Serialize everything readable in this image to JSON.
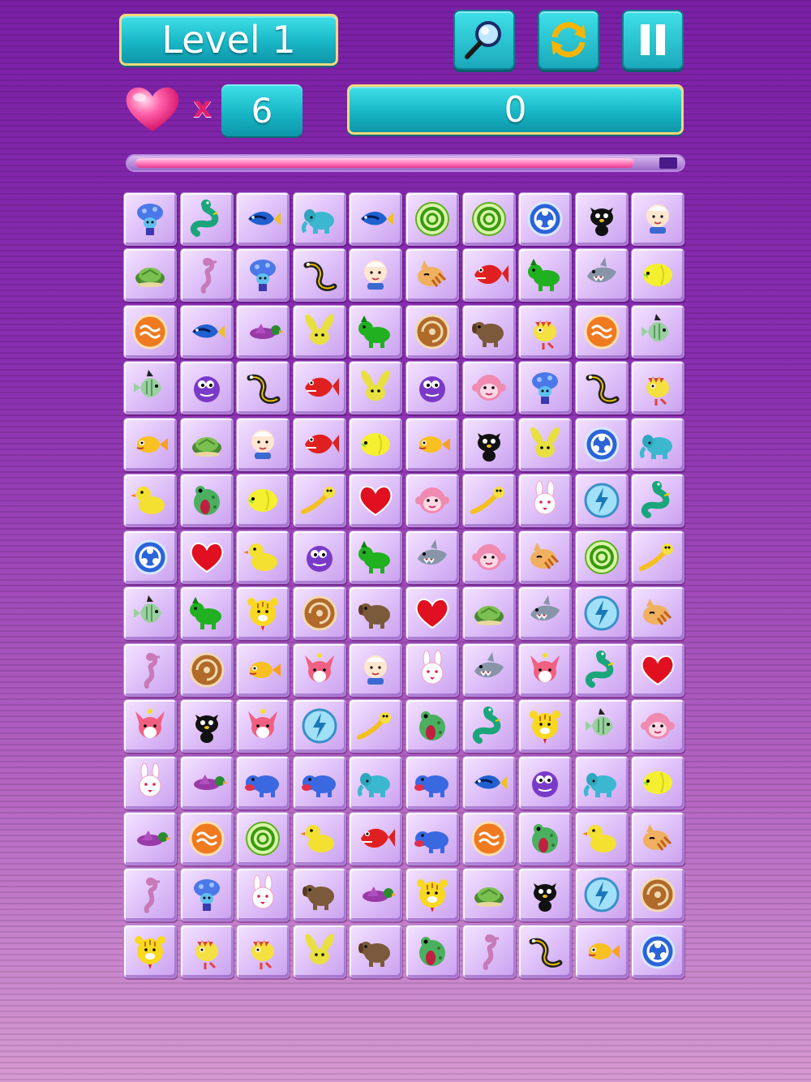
{
  "hud": {
    "level_label": "Level 1",
    "lives": "6",
    "lives_symbol": "x",
    "score": "0",
    "timer_remaining_fraction": 0.96
  },
  "buttons": {
    "hint_icon": "magnifier-icon",
    "shuffle_icon": "shuffle-icon",
    "pause_icon": "pause-icon"
  },
  "board": {
    "rows": 14,
    "cols": 10,
    "tiles": [
      [
        "mushroom-boy",
        "snake",
        "blue-fish",
        "elephant",
        "blue-fish",
        "green-orb",
        "green-orb",
        "blue-orb",
        "black-cat",
        "baby"
      ],
      [
        "turtle",
        "seahorse",
        "mushroom-boy",
        "eel",
        "baby",
        "striped-cat",
        "red-fish",
        "green-dog",
        "shark",
        "yellow-fish"
      ],
      [
        "fire-orb",
        "blue-fish",
        "duck-flying",
        "bunny-ears",
        "green-dog",
        "brown-orb",
        "brown-dog",
        "spiky-fish",
        "fire-orb",
        "angel-fish"
      ],
      [
        "angel-fish",
        "purple-blob",
        "eel",
        "red-fish",
        "bunny-ears",
        "purple-blob",
        "monkey",
        "mushroom-boy",
        "eel",
        "spiky-fish"
      ],
      [
        "goldfish",
        "turtle",
        "baby",
        "red-fish",
        "yellow-fish",
        "goldfish",
        "black-cat",
        "bunny-ears",
        "blue-orb",
        "elephant"
      ],
      [
        "rubber-duck",
        "frog",
        "yellow-fish",
        "comet",
        "heart",
        "monkey",
        "comet",
        "white-bunny",
        "lightning-orb",
        "snake"
      ],
      [
        "blue-orb",
        "heart",
        "rubber-duck",
        "purple-blob",
        "green-dog",
        "shark",
        "monkey",
        "striped-cat",
        "green-orb",
        "comet"
      ],
      [
        "angel-fish",
        "green-dog",
        "tiger",
        "brown-orb",
        "brown-dog",
        "heart",
        "turtle",
        "shark",
        "lightning-orb",
        "striped-cat"
      ],
      [
        "seahorse",
        "brown-orb",
        "goldfish",
        "fox",
        "baby",
        "white-bunny",
        "shark",
        "fox",
        "snake",
        "heart"
      ],
      [
        "fox",
        "black-cat",
        "fox",
        "lightning-orb",
        "comet",
        "frog",
        "snake",
        "tiger",
        "angel-fish",
        "monkey"
      ],
      [
        "white-bunny",
        "duck-flying",
        "blue-dog",
        "blue-dog",
        "elephant",
        "blue-dog",
        "blue-fish",
        "purple-blob",
        "elephant",
        "yellow-fish"
      ],
      [
        "duck-flying",
        "fire-orb",
        "green-orb",
        "rubber-duck",
        "red-fish",
        "blue-dog",
        "fire-orb",
        "frog",
        "rubber-duck",
        "striped-cat"
      ],
      [
        "seahorse",
        "mushroom-boy",
        "white-bunny",
        "brown-dog",
        "duck-flying",
        "tiger",
        "turtle",
        "black-cat",
        "lightning-orb",
        "brown-orb"
      ],
      [
        "tiger",
        "spiky-fish",
        "spiky-fish",
        "bunny-ears",
        "brown-dog",
        "frog",
        "seahorse",
        "eel",
        "goldfish",
        "blue-orb"
      ]
    ]
  }
}
